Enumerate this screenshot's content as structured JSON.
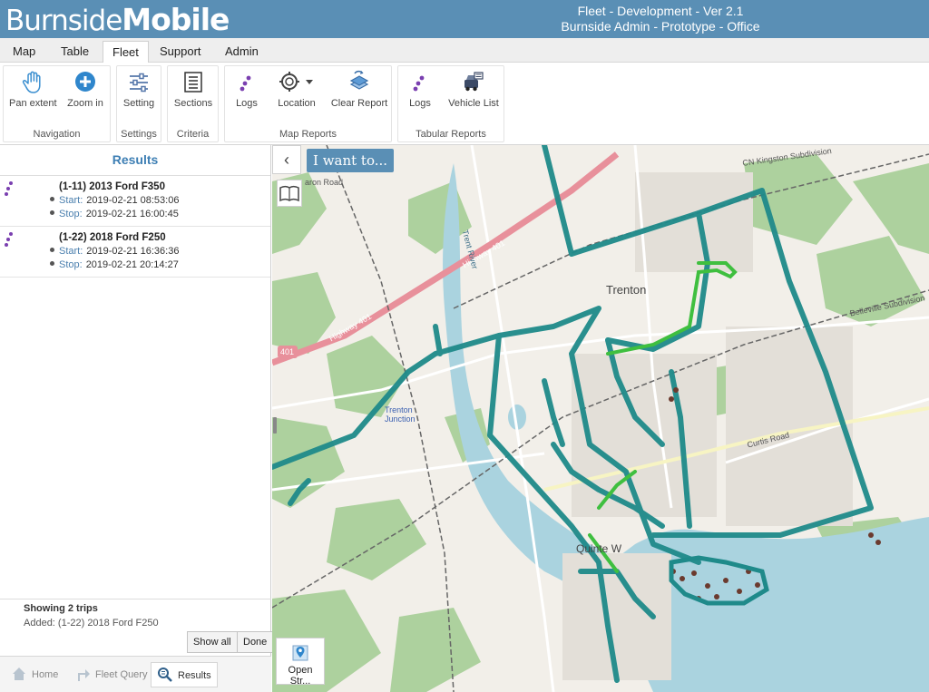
{
  "header": {
    "logo_part1": "Burnside",
    "logo_part2": "Mobile",
    "line1": "Fleet - Development - Ver 2.1",
    "line2": "Burnside Admin - Prototype - Office"
  },
  "tabs": [
    {
      "label": "Map"
    },
    {
      "label": "Table"
    },
    {
      "label": "Fleet",
      "active": true
    },
    {
      "label": "Support"
    },
    {
      "label": "Admin"
    }
  ],
  "ribbon": {
    "groups": {
      "navigation": "Navigation",
      "settings": "Settings",
      "criteria": "Criteria",
      "map_reports": "Map Reports",
      "tabular_reports": "Tabular Reports"
    },
    "buttons": {
      "pan_extent": "Pan extent",
      "zoom_in": "Zoom in",
      "setting": "Setting",
      "sections": "Sections",
      "logs_map": "Logs",
      "location": "Location",
      "clear_report": "Clear Report",
      "logs_tab": "Logs",
      "vehicle_list": "Vehicle List"
    }
  },
  "results": {
    "title": "Results",
    "start_label": "Start:",
    "stop_label": "Stop:",
    "trips": [
      {
        "name": "(1-11) 2013 Ford F350",
        "start": "2019-02-21 08:53:06",
        "stop": "2019-02-21 16:00:45"
      },
      {
        "name": "(1-22) 2018 Ford F250",
        "start": "2019-02-21 16:36:36",
        "stop": "2019-02-21 20:14:27"
      }
    ],
    "summary": {
      "count": "Showing 2 trips",
      "added": "Added: (1-22) 2018 Ford F250"
    },
    "show_all": "Show all",
    "done": "Done"
  },
  "bottom_nav": {
    "home": "Home",
    "fleet_query": "Fleet Query",
    "results": "Results"
  },
  "map": {
    "i_want_to": "I want to...",
    "open_street": "Open Str...",
    "labels": {
      "trenton": "Trenton",
      "quinte": "Quinte W",
      "curtis_road": "Curtis Road",
      "highway": "Highway 401",
      "rail_cn": "CN Kingston Subdivision",
      "rail_bv": "Belleville Subdivision",
      "trent_river": "Trent River",
      "trenton_junction": "Trenton Junction",
      "shield_401": "401",
      "baron_road": "aron Road"
    },
    "colors": {
      "route_teal": "#1f8a8a",
      "route_green": "#3fbf3f",
      "water": "#aad3df",
      "park": "#add19e",
      "highway": "#e8909b"
    }
  }
}
